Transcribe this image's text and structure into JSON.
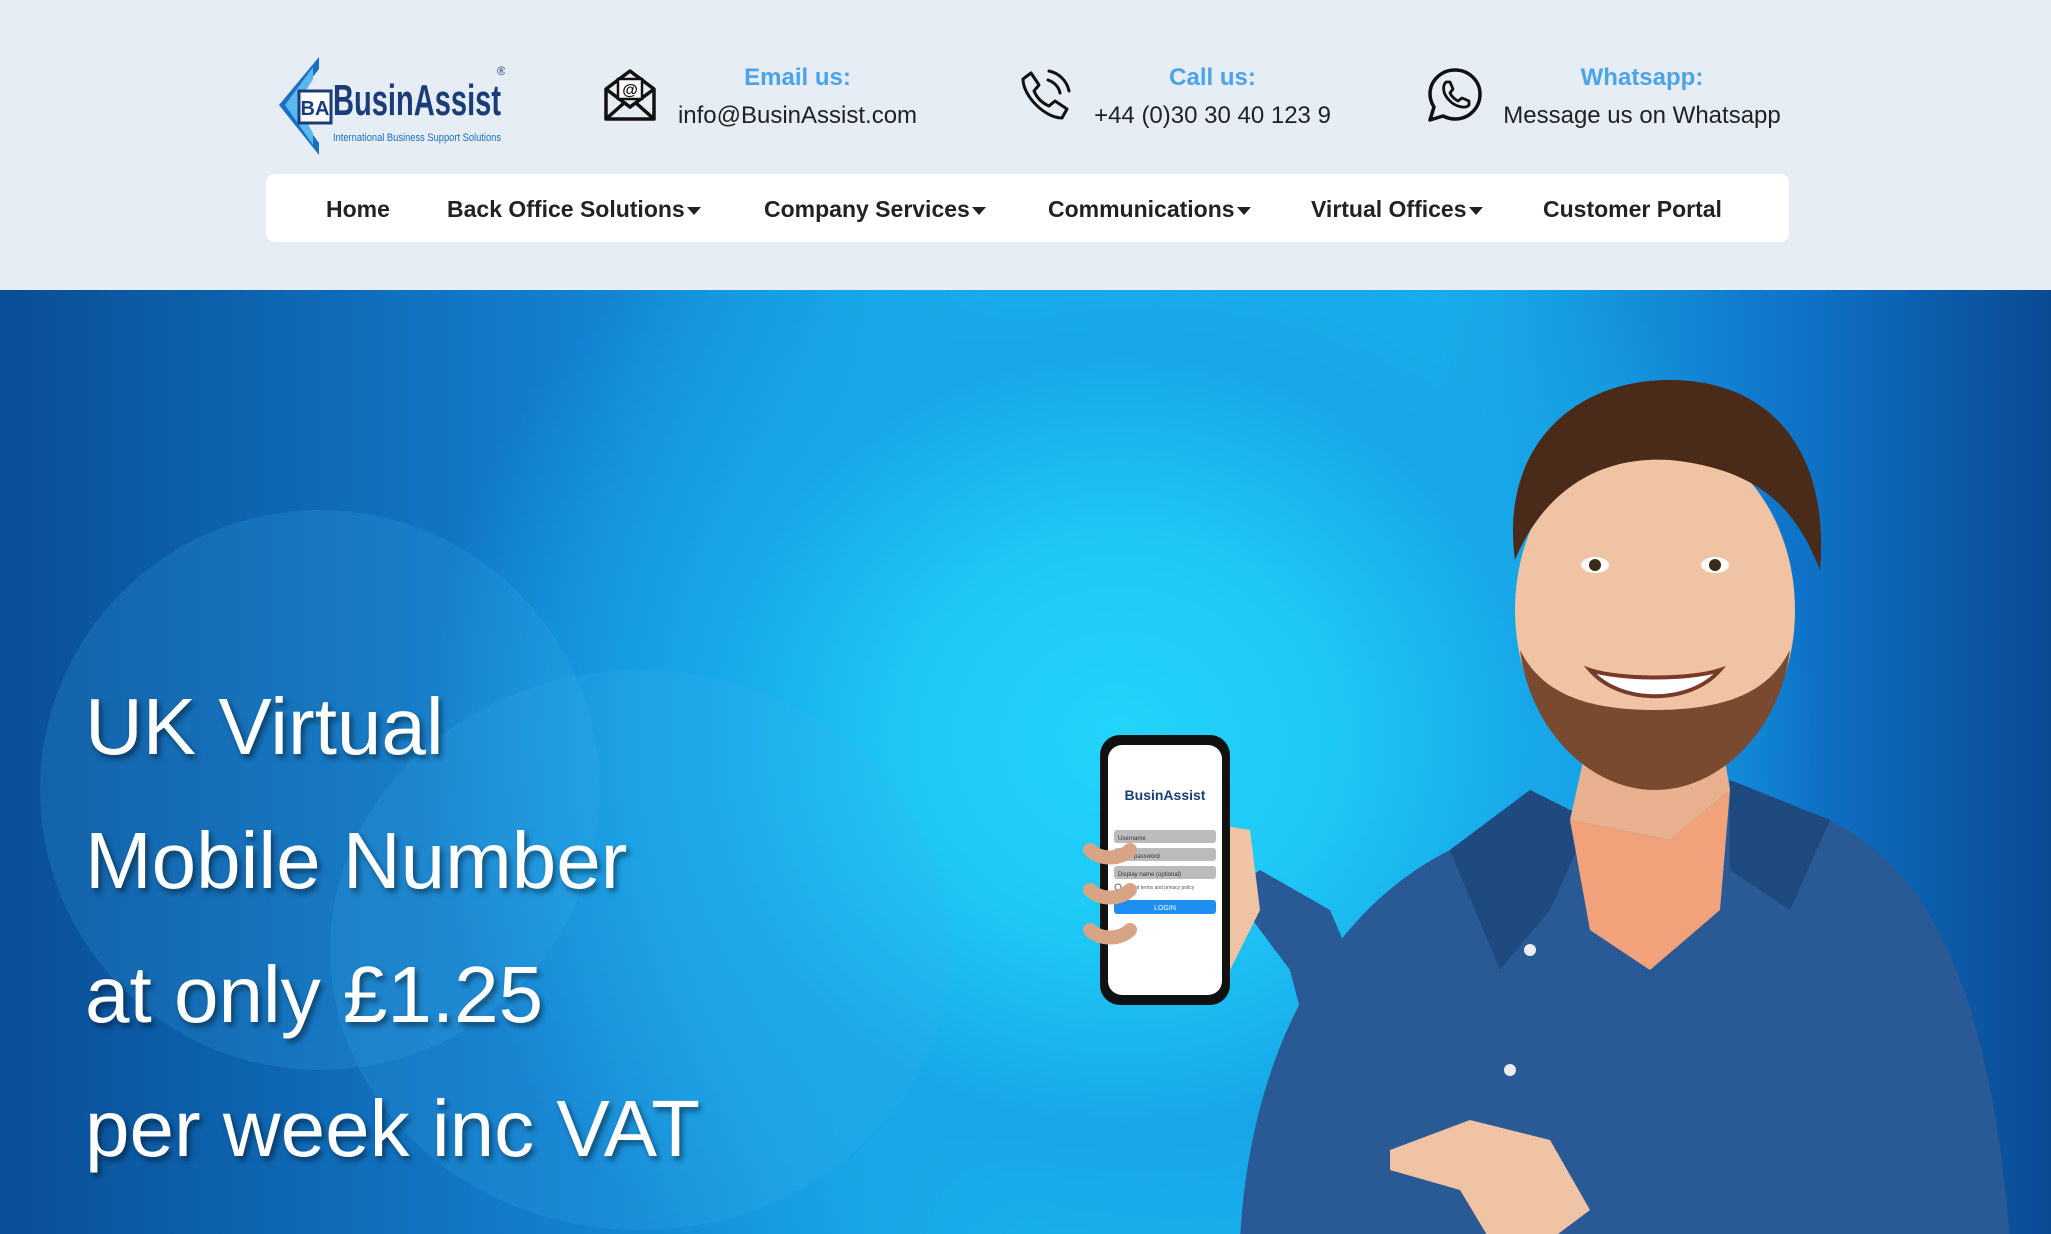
{
  "brand": {
    "name": "BusinAssist",
    "monogram": "BA",
    "tagline": "International Business Support Solutions",
    "registered": "®"
  },
  "contacts": {
    "email": {
      "label": "Email us:",
      "value": "info@BusinAssist.com",
      "icon": "email-icon"
    },
    "call": {
      "label": "Call us:",
      "value": "+44 (0)30 30 40 123 9",
      "icon": "phone-icon"
    },
    "whatsapp": {
      "label": "Whatsapp:",
      "value": "Message us on Whatsapp",
      "icon": "whatsapp-icon"
    }
  },
  "nav": {
    "items": [
      {
        "label": "Home",
        "dropdown": false
      },
      {
        "label": "Back Office Solutions",
        "dropdown": true
      },
      {
        "label": "Company Services",
        "dropdown": true
      },
      {
        "label": "Communications",
        "dropdown": true
      },
      {
        "label": "Virtual Offices",
        "dropdown": true
      },
      {
        "label": "Customer Portal",
        "dropdown": false
      }
    ]
  },
  "hero": {
    "lines": [
      "UK Virtual",
      "Mobile Number",
      "at only £1.25",
      "per week inc VAT"
    ]
  },
  "phone_screen": {
    "brand": "BusinAssist",
    "fields": [
      "Username",
      "Enter password",
      "Display name (optional)"
    ],
    "remember": "Accept terms and privacy policy",
    "button": "LOGIN"
  },
  "colors": {
    "accent": "#4ba3e8",
    "header_bg": "#e6edf4",
    "hero_light": "#22d4fa",
    "hero_dark": "#0a4e96"
  }
}
